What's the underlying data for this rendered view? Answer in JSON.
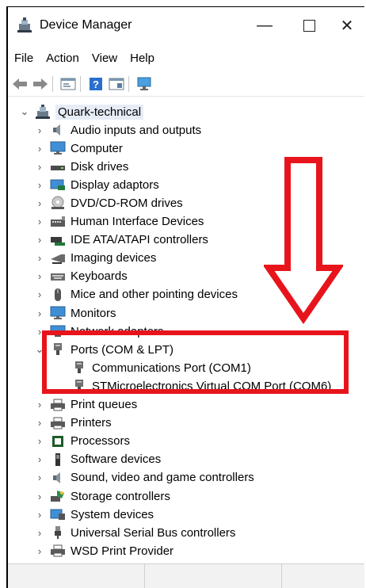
{
  "window": {
    "title": "Device Manager",
    "min_glyph": "—",
    "close_glyph": "✕"
  },
  "menu": [
    "File",
    "Action",
    "View",
    "Help"
  ],
  "tree": {
    "root": "Quark-technical",
    "items": [
      {
        "label": "Audio inputs and outputs",
        "icon": "speaker-icon"
      },
      {
        "label": "Computer",
        "icon": "monitor-icon"
      },
      {
        "label": "Disk drives",
        "icon": "disk-drive-icon"
      },
      {
        "label": "Display adaptors",
        "icon": "display-adapter-icon"
      },
      {
        "label": "DVD/CD-ROM drives",
        "icon": "dvd-icon"
      },
      {
        "label": "Human Interface Devices",
        "icon": "hid-icon"
      },
      {
        "label": "IDE ATA/ATAPI controllers",
        "icon": "ide-icon"
      },
      {
        "label": "Imaging devices",
        "icon": "camera-icon"
      },
      {
        "label": "Keyboards",
        "icon": "keyboard-icon"
      },
      {
        "label": "Mice and other pointing devices",
        "icon": "mouse-icon"
      },
      {
        "label": "Monitors",
        "icon": "monitor-icon"
      },
      {
        "label": "Network adapters",
        "icon": "network-icon"
      },
      {
        "label": "Ports (COM & LPT)",
        "icon": "port-icon",
        "expanded": true
      },
      {
        "label": "Communications Port (COM1)",
        "icon": "port-icon",
        "child": true
      },
      {
        "label": "STMicroelectronics Virtual COM Port (COM6)",
        "icon": "port-icon",
        "child": true
      },
      {
        "label": "Print queues",
        "icon": "printer-icon"
      },
      {
        "label": "Printers",
        "icon": "printer-icon"
      },
      {
        "label": "Processors",
        "icon": "processor-icon"
      },
      {
        "label": "Software devices",
        "icon": "software-device-icon"
      },
      {
        "label": "Sound, video and game controllers",
        "icon": "speaker-icon"
      },
      {
        "label": "Storage controllers",
        "icon": "storage-icon"
      },
      {
        "label": "System devices",
        "icon": "system-icon"
      },
      {
        "label": "Universal Serial Bus controllers",
        "icon": "usb-icon"
      },
      {
        "label": "WSD Print Provider",
        "icon": "printer-icon"
      }
    ]
  },
  "colors": {
    "annotation": "#e8141c",
    "selection": "#e6edf7"
  }
}
